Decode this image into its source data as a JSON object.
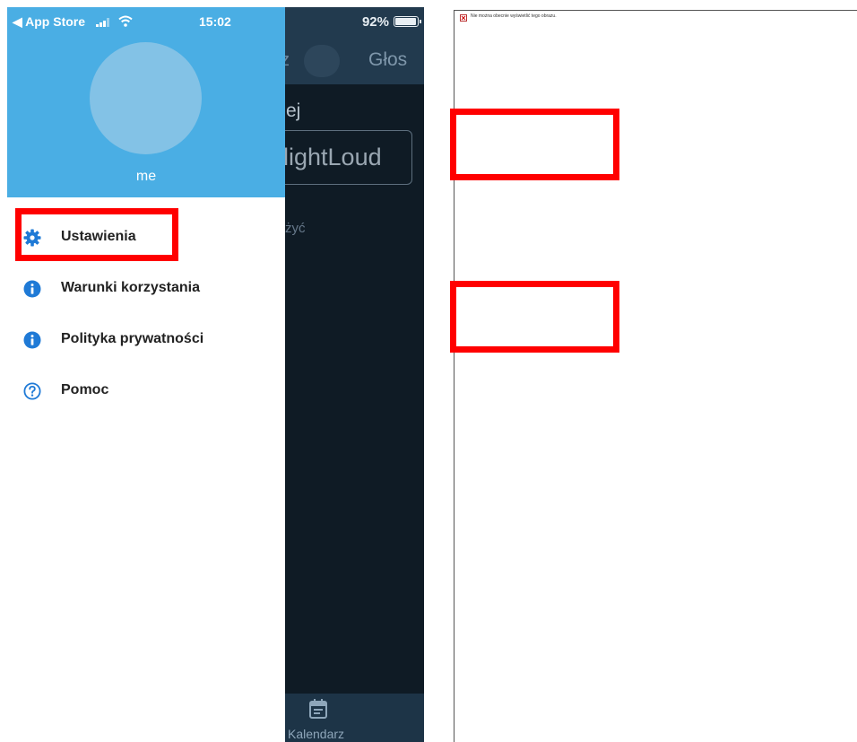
{
  "status_bar": {
    "back_label": "◀ App Store",
    "time": "15:02",
    "battery_percent": "92%"
  },
  "background_app": {
    "header_partial_left": "z",
    "header_right": "Głos",
    "section_label_partial": "ej",
    "input_value_partial": "lightLoud",
    "hint_partial": "żyć",
    "bottom_tab_label": "Kalendarz"
  },
  "drawer": {
    "profile_name": "me",
    "items": [
      {
        "label": "Ustawienia",
        "icon": "gear-icon"
      },
      {
        "label": "Warunki korzystania",
        "icon": "info-icon"
      },
      {
        "label": "Polityka prywatności",
        "icon": "info-icon"
      },
      {
        "label": "Pomoc",
        "icon": "help-icon"
      }
    ]
  },
  "document_panel": {
    "broken_image_text": "Nie można obecnie wyświetlić tego obrazu."
  },
  "colors": {
    "drawer_header": "#4aaee4",
    "avatar": "#83c2e6",
    "icon_blue": "#1f7ad6",
    "annotation_red": "#ff0000",
    "app_background": "#0f1b25"
  }
}
